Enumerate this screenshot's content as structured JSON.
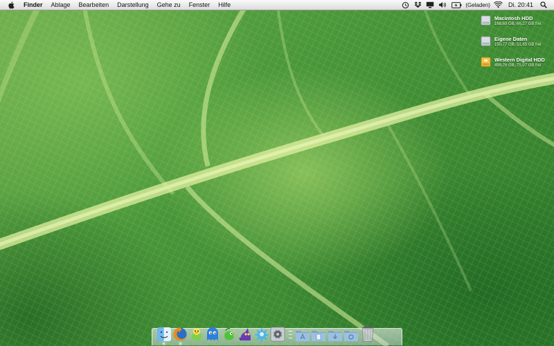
{
  "menubar": {
    "apple_menu": "apple-icon",
    "items": [
      "Finder",
      "Ablage",
      "Bearbeiten",
      "Darstellung",
      "Gehe zu",
      "Fenster",
      "Hilfe"
    ],
    "status": {
      "battery_text": "(Geladen)",
      "clock": "Di. 20:41"
    }
  },
  "drives": [
    {
      "name": "Macintosh HDD",
      "info": "168,69 GB, 66,27 GB frei",
      "icon": "internal-drive-icon"
    },
    {
      "name": "Eigene Daten",
      "info": "150,77 GB, 51,85 GB frei",
      "icon": "internal-drive-icon"
    },
    {
      "name": "Western Digital HDD",
      "info": "499,76 GB, 75,07 GB frei",
      "icon": "external-drive-icon"
    }
  ],
  "dock": {
    "apps": [
      {
        "name": "finder",
        "running": true
      },
      {
        "name": "firefox",
        "running": true
      },
      {
        "name": "adium",
        "running": false
      },
      {
        "name": "blue-monster-app",
        "running": false
      },
      {
        "name": "green-bird-app",
        "running": false
      },
      {
        "name": "purple-creature-app",
        "running": false
      },
      {
        "name": "blue-burst-app",
        "running": false
      },
      {
        "name": "system-preferences",
        "running": false
      }
    ],
    "stacks": [
      "applications-folder",
      "documents-folder",
      "downloads-folder",
      "utilities-folder"
    ],
    "trash": "trash-icon"
  },
  "colors": {
    "wallpaper_green": "#4d9a3c",
    "menubar": "#e9e9e9"
  }
}
